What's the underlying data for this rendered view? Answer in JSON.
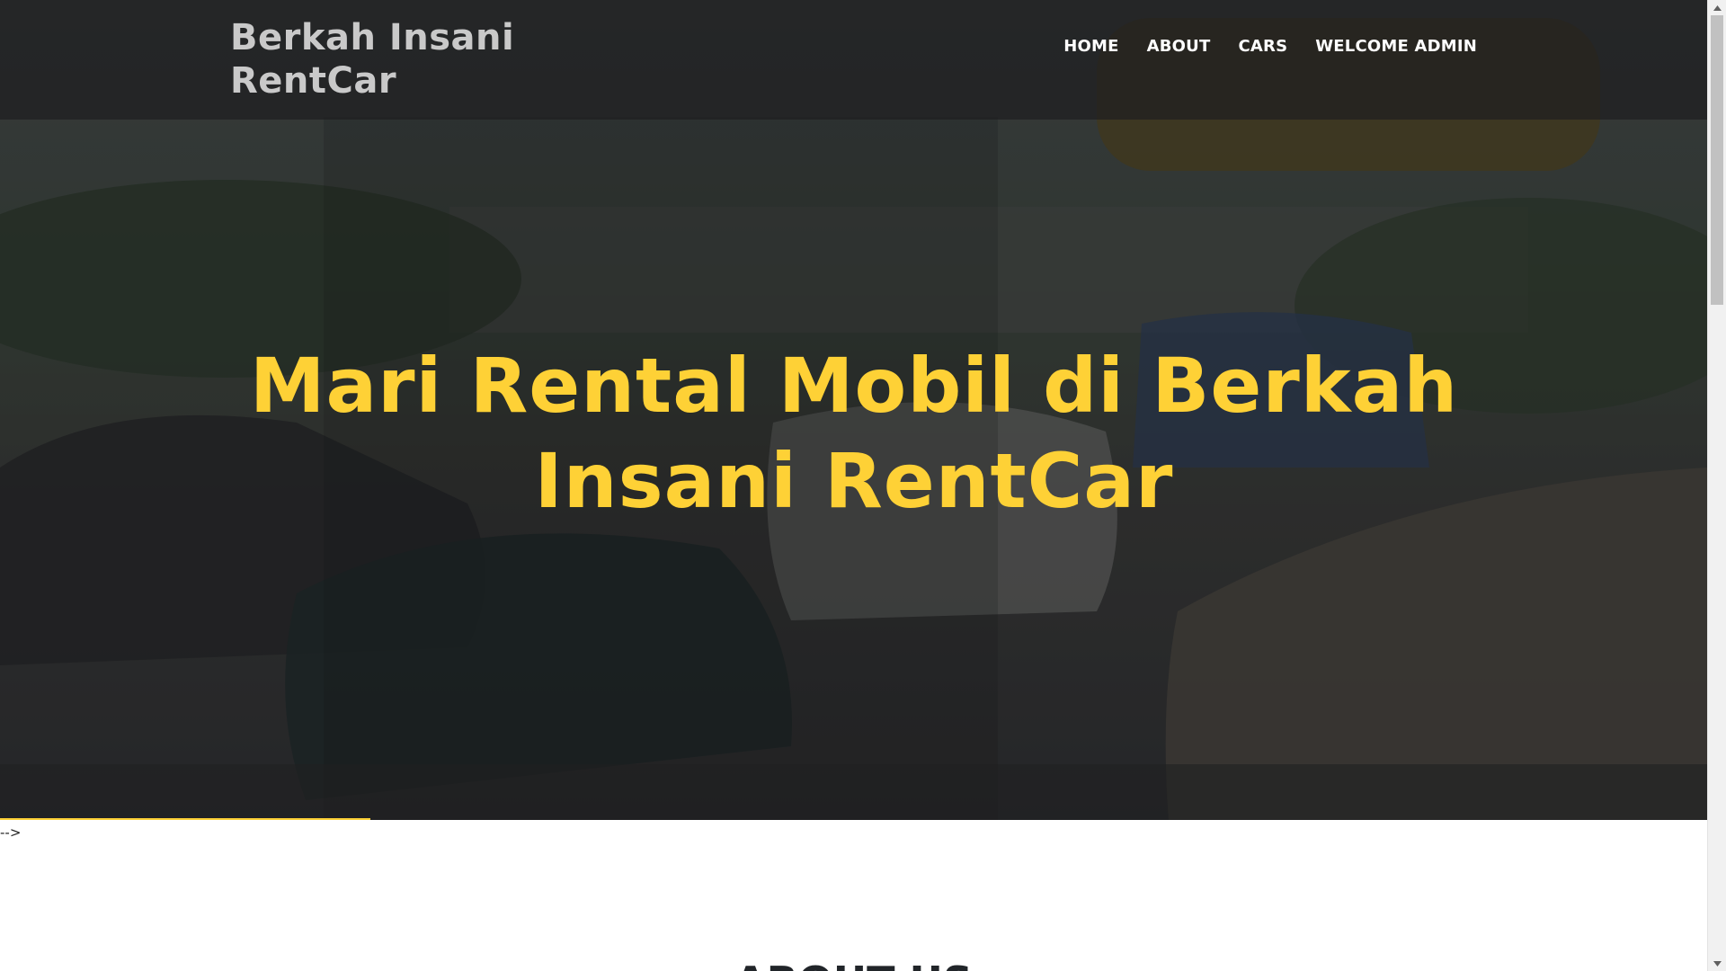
{
  "navbar": {
    "brand": "Berkah Insani RentCar",
    "links": [
      {
        "label": "HOME"
      },
      {
        "label": "ABOUT"
      },
      {
        "label": "CARS"
      },
      {
        "label": "WELCOME ADMIN"
      }
    ]
  },
  "hero": {
    "title": "Mari Rental Mobil di Berkah Insani RentCar"
  },
  "body": {
    "stray_text": "-->",
    "about_heading": "ABOUT US"
  },
  "colors": {
    "accent": "#fed136",
    "nav_text": "#ffffff",
    "brand_text": "#c9c9c9"
  }
}
